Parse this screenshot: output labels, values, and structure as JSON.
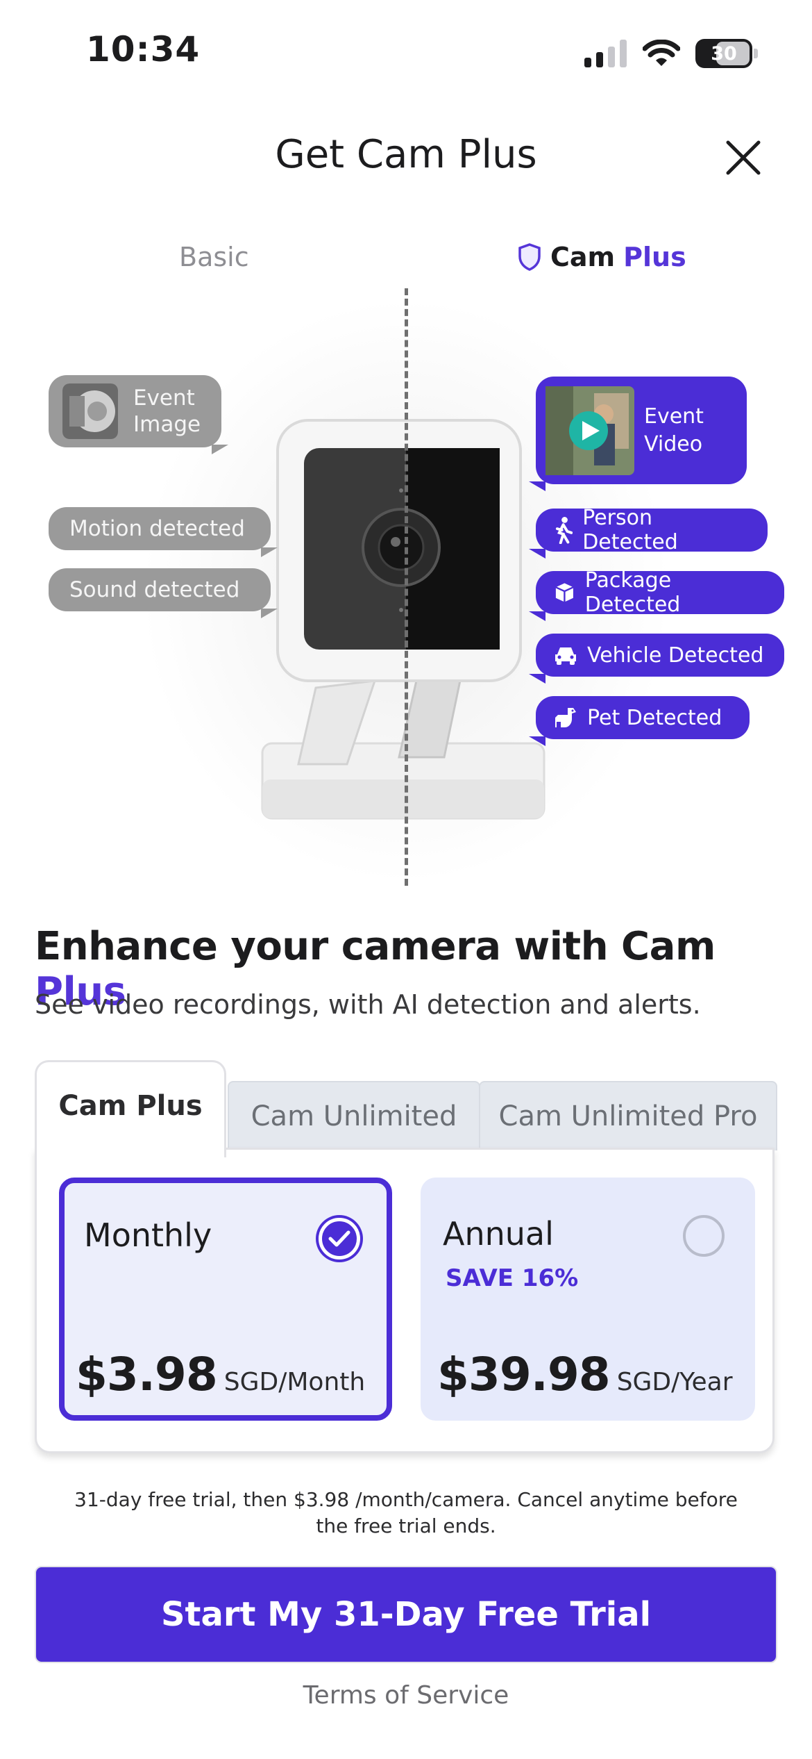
{
  "status_bar": {
    "time": "10:34",
    "battery": "30"
  },
  "header": {
    "title": "Get Cam Plus"
  },
  "hero": {
    "basic_label": "Basic",
    "plus_label_prefix": "Cam",
    "plus_label_accent": "Plus",
    "basic_features": {
      "event_image_line1": "Event",
      "event_image_line2": "Image",
      "motion": "Motion detected",
      "sound": "Sound detected"
    },
    "plus_features": {
      "event_video_line1": "Event",
      "event_video_line2": "Video",
      "person": "Person Detected",
      "package": "Package Detected",
      "vehicle": "Vehicle Detected",
      "pet": "Pet Detected"
    }
  },
  "headline": {
    "prefix": "Enhance your camera with Cam",
    "accent": "Plus"
  },
  "subline": "See video recordings, with AI detection and alerts.",
  "tabs": [
    {
      "label": "Cam Plus",
      "active": true
    },
    {
      "label": "Cam Unlimited",
      "active": false
    },
    {
      "label": "Cam Unlimited Pro",
      "active": false
    }
  ],
  "plans": {
    "monthly": {
      "name": "Monthly",
      "price": "$3.98",
      "unit": "SGD/Month",
      "selected": true
    },
    "annual": {
      "name": "Annual",
      "save": "SAVE 16%",
      "price": "$39.98",
      "unit": "SGD/Year",
      "selected": false
    }
  },
  "fine_print": "31-day free trial, then $3.98 /month/camera. Cancel anytime before the free trial ends.",
  "cta_label": "Start My 31-Day Free Trial",
  "terms_label": "Terms of Service",
  "colors": {
    "accent": "#4b2dd6",
    "basic_gray": "#9a9a9a"
  }
}
